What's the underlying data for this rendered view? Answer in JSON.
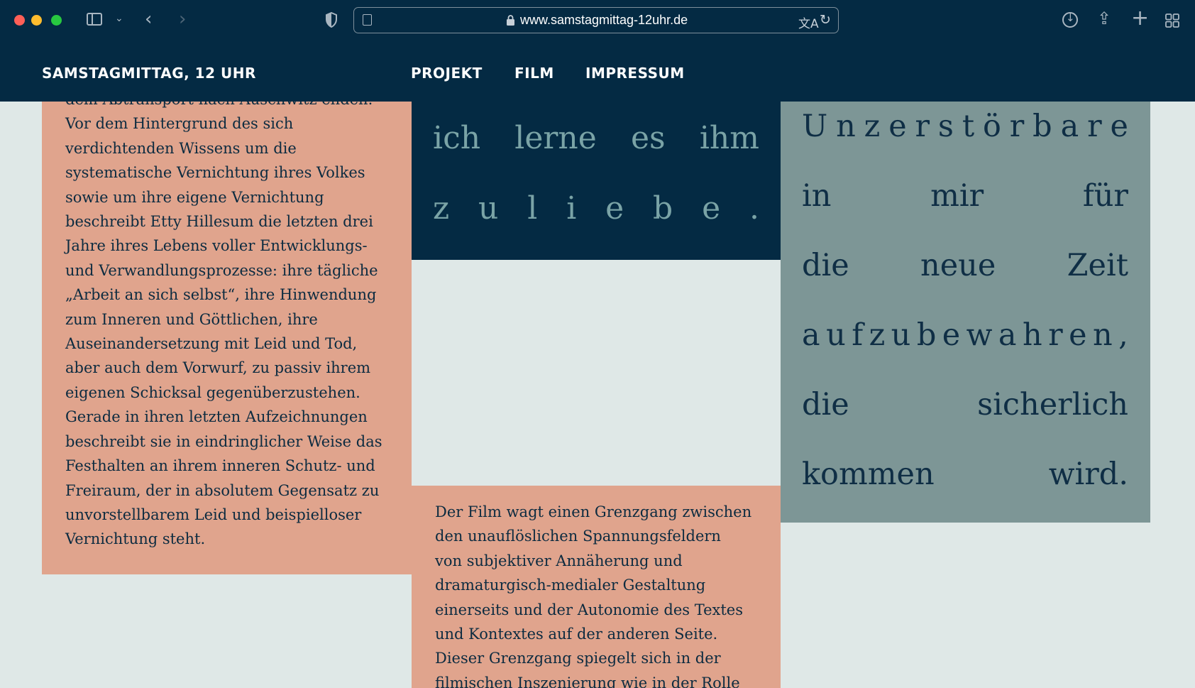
{
  "browser": {
    "url": "www.samstagmittag-12uhr.de"
  },
  "site": {
    "brand": "SAMSTAGMITTAG, 12 UHR",
    "nav": [
      "PROJEKT",
      "FILM",
      "IMPRESSUM"
    ]
  },
  "left_panel": {
    "lines": [
      "dem Abtransport nach Auschwitz enden.",
      "Vor dem Hintergrund des sich",
      "verdichtenden Wissens um die",
      "systematische Vernichtung ihres Volkes",
      "sowie um ihre eigene Vernichtung",
      "beschreibt Etty Hillesum die letzten drei",
      "Jahre ihres Lebens voller Entwicklungs-",
      "und Verwandlungsprozesse: ihre tägliche",
      "„Arbeit an sich selbst“, ihre Hinwendung",
      "zum Inneren und Göttlichen, ihre",
      "Auseinandersetzung mit Leid und Tod,",
      "aber auch dem Vorwurf, zu passiv ihrem",
      "eigenen Schicksal gegenüberzustehen.",
      "Gerade in ihren letzten Aufzeichnungen",
      "beschreibt sie in eindringlicher Weise das",
      "Festhalten an ihrem inneren Schutz- und",
      "Freiraum, der in absolutem Gegensatz zu",
      "unvorstellbarem Leid und beispielloser",
      "Vernichtung steht."
    ]
  },
  "quote_dark": {
    "line1": [
      "ich",
      "lerne",
      "es",
      "ihm"
    ],
    "line2": [
      "z",
      "u",
      "l",
      "i",
      "e",
      "b",
      "e",
      "."
    ]
  },
  "quote_grey": {
    "lines": [
      [
        "U",
        "n",
        "z",
        "e",
        "r",
        "s",
        "t",
        "ö",
        "r",
        "b",
        "a",
        "r",
        "e"
      ],
      [
        "in",
        "mir",
        "für"
      ],
      [
        "die",
        "neue",
        "Zeit"
      ],
      [
        "a",
        "u",
        "f",
        "z",
        "u",
        "b",
        "e",
        "w",
        "a",
        "h",
        "r",
        "e",
        "n",
        ","
      ],
      [
        "die",
        "sicherlich"
      ],
      [
        "kommen",
        "wird."
      ]
    ]
  },
  "film_panel": {
    "lines": [
      "Der Film wagt einen Grenzgang zwischen",
      "den unauflöslichen Spannungsfeldern",
      "von subjektiver Annäherung und",
      "dramaturgisch-medialer Gestaltung",
      "einerseits und der Autonomie des Textes",
      "und Kontextes auf der anderen Seite.",
      "Dieser Grenzgang spiegelt sich in der",
      "filmischen Inszenierung wie in der Rolle"
    ]
  },
  "colors": {
    "navy": "#042a43",
    "salmon": "#e0a48d",
    "slate": "#7d9696",
    "background": "#dfe8e7",
    "teal_text": "#7aa3a6"
  }
}
